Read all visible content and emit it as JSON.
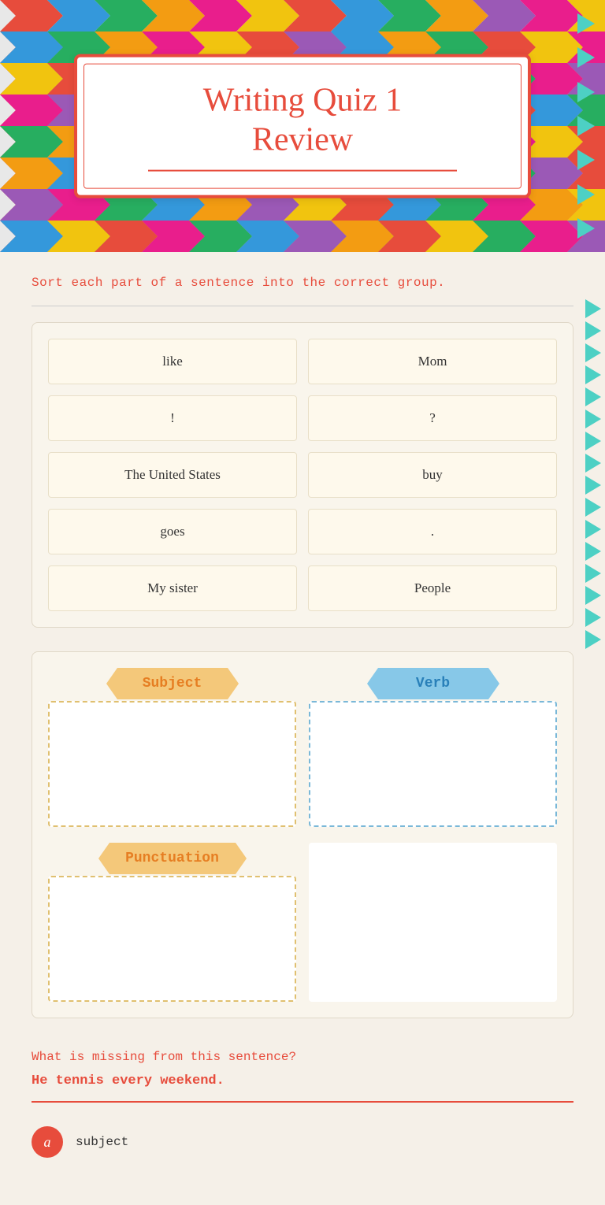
{
  "header": {
    "title_line1": "Writing Quiz 1",
    "title_line2": "Review"
  },
  "instruction": {
    "text": "Sort each part of a sentence into the correct group."
  },
  "word_tiles": [
    {
      "id": "tile-like",
      "text": "like"
    },
    {
      "id": "tile-mom",
      "text": "Mom"
    },
    {
      "id": "tile-exclaim",
      "text": "!"
    },
    {
      "id": "tile-question",
      "text": "?"
    },
    {
      "id": "tile-us",
      "text": "The United States"
    },
    {
      "id": "tile-buy",
      "text": "buy"
    },
    {
      "id": "tile-goes",
      "text": "goes"
    },
    {
      "id": "tile-period",
      "text": "."
    },
    {
      "id": "tile-mysister",
      "text": "My sister"
    },
    {
      "id": "tile-people",
      "text": "People"
    }
  ],
  "categories": {
    "subject": {
      "label": "Subject"
    },
    "verb": {
      "label": "Verb"
    },
    "punctuation": {
      "label": "Punctuation"
    }
  },
  "question_section": {
    "question": "What is missing from this sentence?",
    "sentence": "He tennis every weekend.",
    "answer_a": {
      "letter": "a",
      "text": "subject"
    }
  },
  "colors": {
    "orange": "#e74c3c",
    "ribbon_orange": "#f4c87a",
    "ribbon_orange_text": "#e67e22",
    "ribbon_blue": "#87c8e8",
    "ribbon_blue_text": "#2980b9",
    "tile_bg": "#fef9ec",
    "dashed_orange": "#e0c070",
    "dashed_blue": "#7ab8d8"
  }
}
